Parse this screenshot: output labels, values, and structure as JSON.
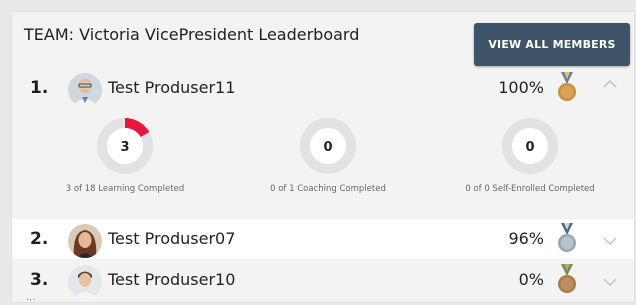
{
  "header": {
    "title": "TEAM: Victoria VicePresident Leaderboard",
    "view_all_label": "VIEW ALL MEMBERS"
  },
  "members": [
    {
      "rank": "1.",
      "name": "Test Produser11",
      "percent": "100%",
      "medal": "gold-medal",
      "expanded": true
    },
    {
      "rank": "2.",
      "name": "Test Produser07",
      "percent": "96%",
      "medal": "silver-medal",
      "expanded": false
    },
    {
      "rank": "3.",
      "name": "Test Produser10",
      "percent": "0%",
      "medal": "bronze-medal",
      "expanded": false
    }
  ],
  "stats": [
    {
      "value": "3",
      "label": "3 of 18 Learning Completed",
      "fraction": 0.1667
    },
    {
      "value": "0",
      "label": "0 of 1 Coaching Completed",
      "fraction": 0
    },
    {
      "value": "0",
      "label": "0 of 0 Self-Enrolled Completed",
      "fraction": 0
    }
  ],
  "colors": {
    "button_bg": "#3f5368",
    "progress": "#e8163d",
    "ring_track": "#e2e2e2",
    "gold": "#c9913f",
    "silver": "#9aa7b3",
    "bronze": "#a87a4c"
  },
  "more_indicator": "..."
}
